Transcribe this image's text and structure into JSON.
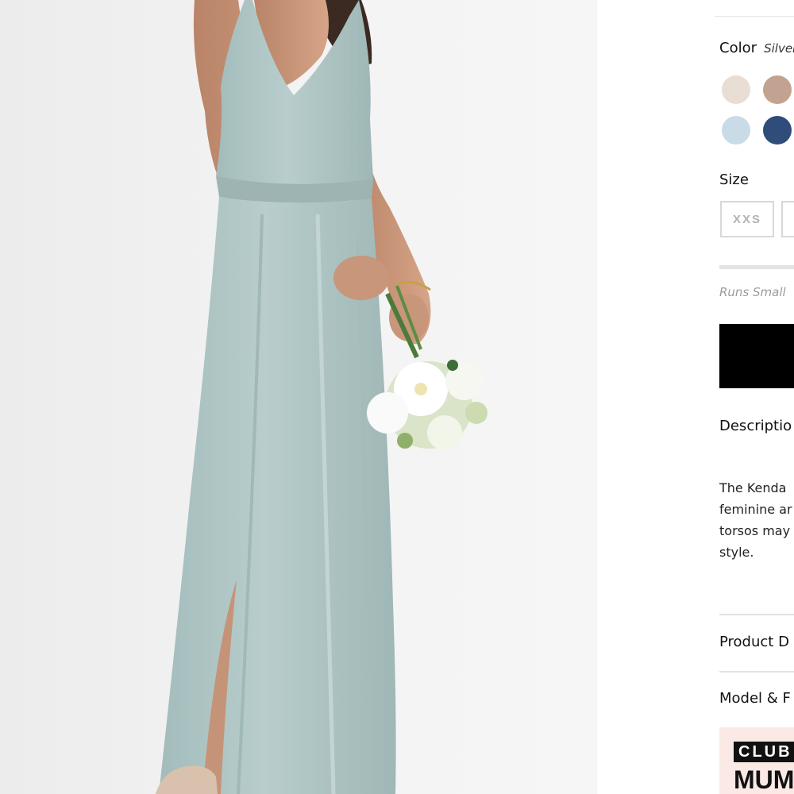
{
  "color": {
    "label": "Color",
    "selected_name": "Silver",
    "swatches": [
      {
        "name": "cream",
        "hex": "#e9ded4"
      },
      {
        "name": "taupe",
        "hex": "#c2a290"
      },
      {
        "name": "light-blue",
        "hex": "#c9dbe6"
      },
      {
        "name": "navy",
        "hex": "#2f4c7a"
      }
    ]
  },
  "size": {
    "label": "Size",
    "options": [
      "XXS",
      ""
    ],
    "fit_note": "Runs Small"
  },
  "sections": {
    "description": "Descriptio",
    "description_lines": [
      "The Kenda",
      "feminine ar",
      "torsos may",
      "style."
    ],
    "product_details": "Product D",
    "model_fit": "Model & F"
  },
  "banner": {
    "top": "CLUB",
    "bottom": "MUM"
  },
  "colors": {
    "primary_button": "#000000",
    "photo_background": "#efefef",
    "dress": "#b2c8c7",
    "banner_background": "#fbe9e6"
  }
}
